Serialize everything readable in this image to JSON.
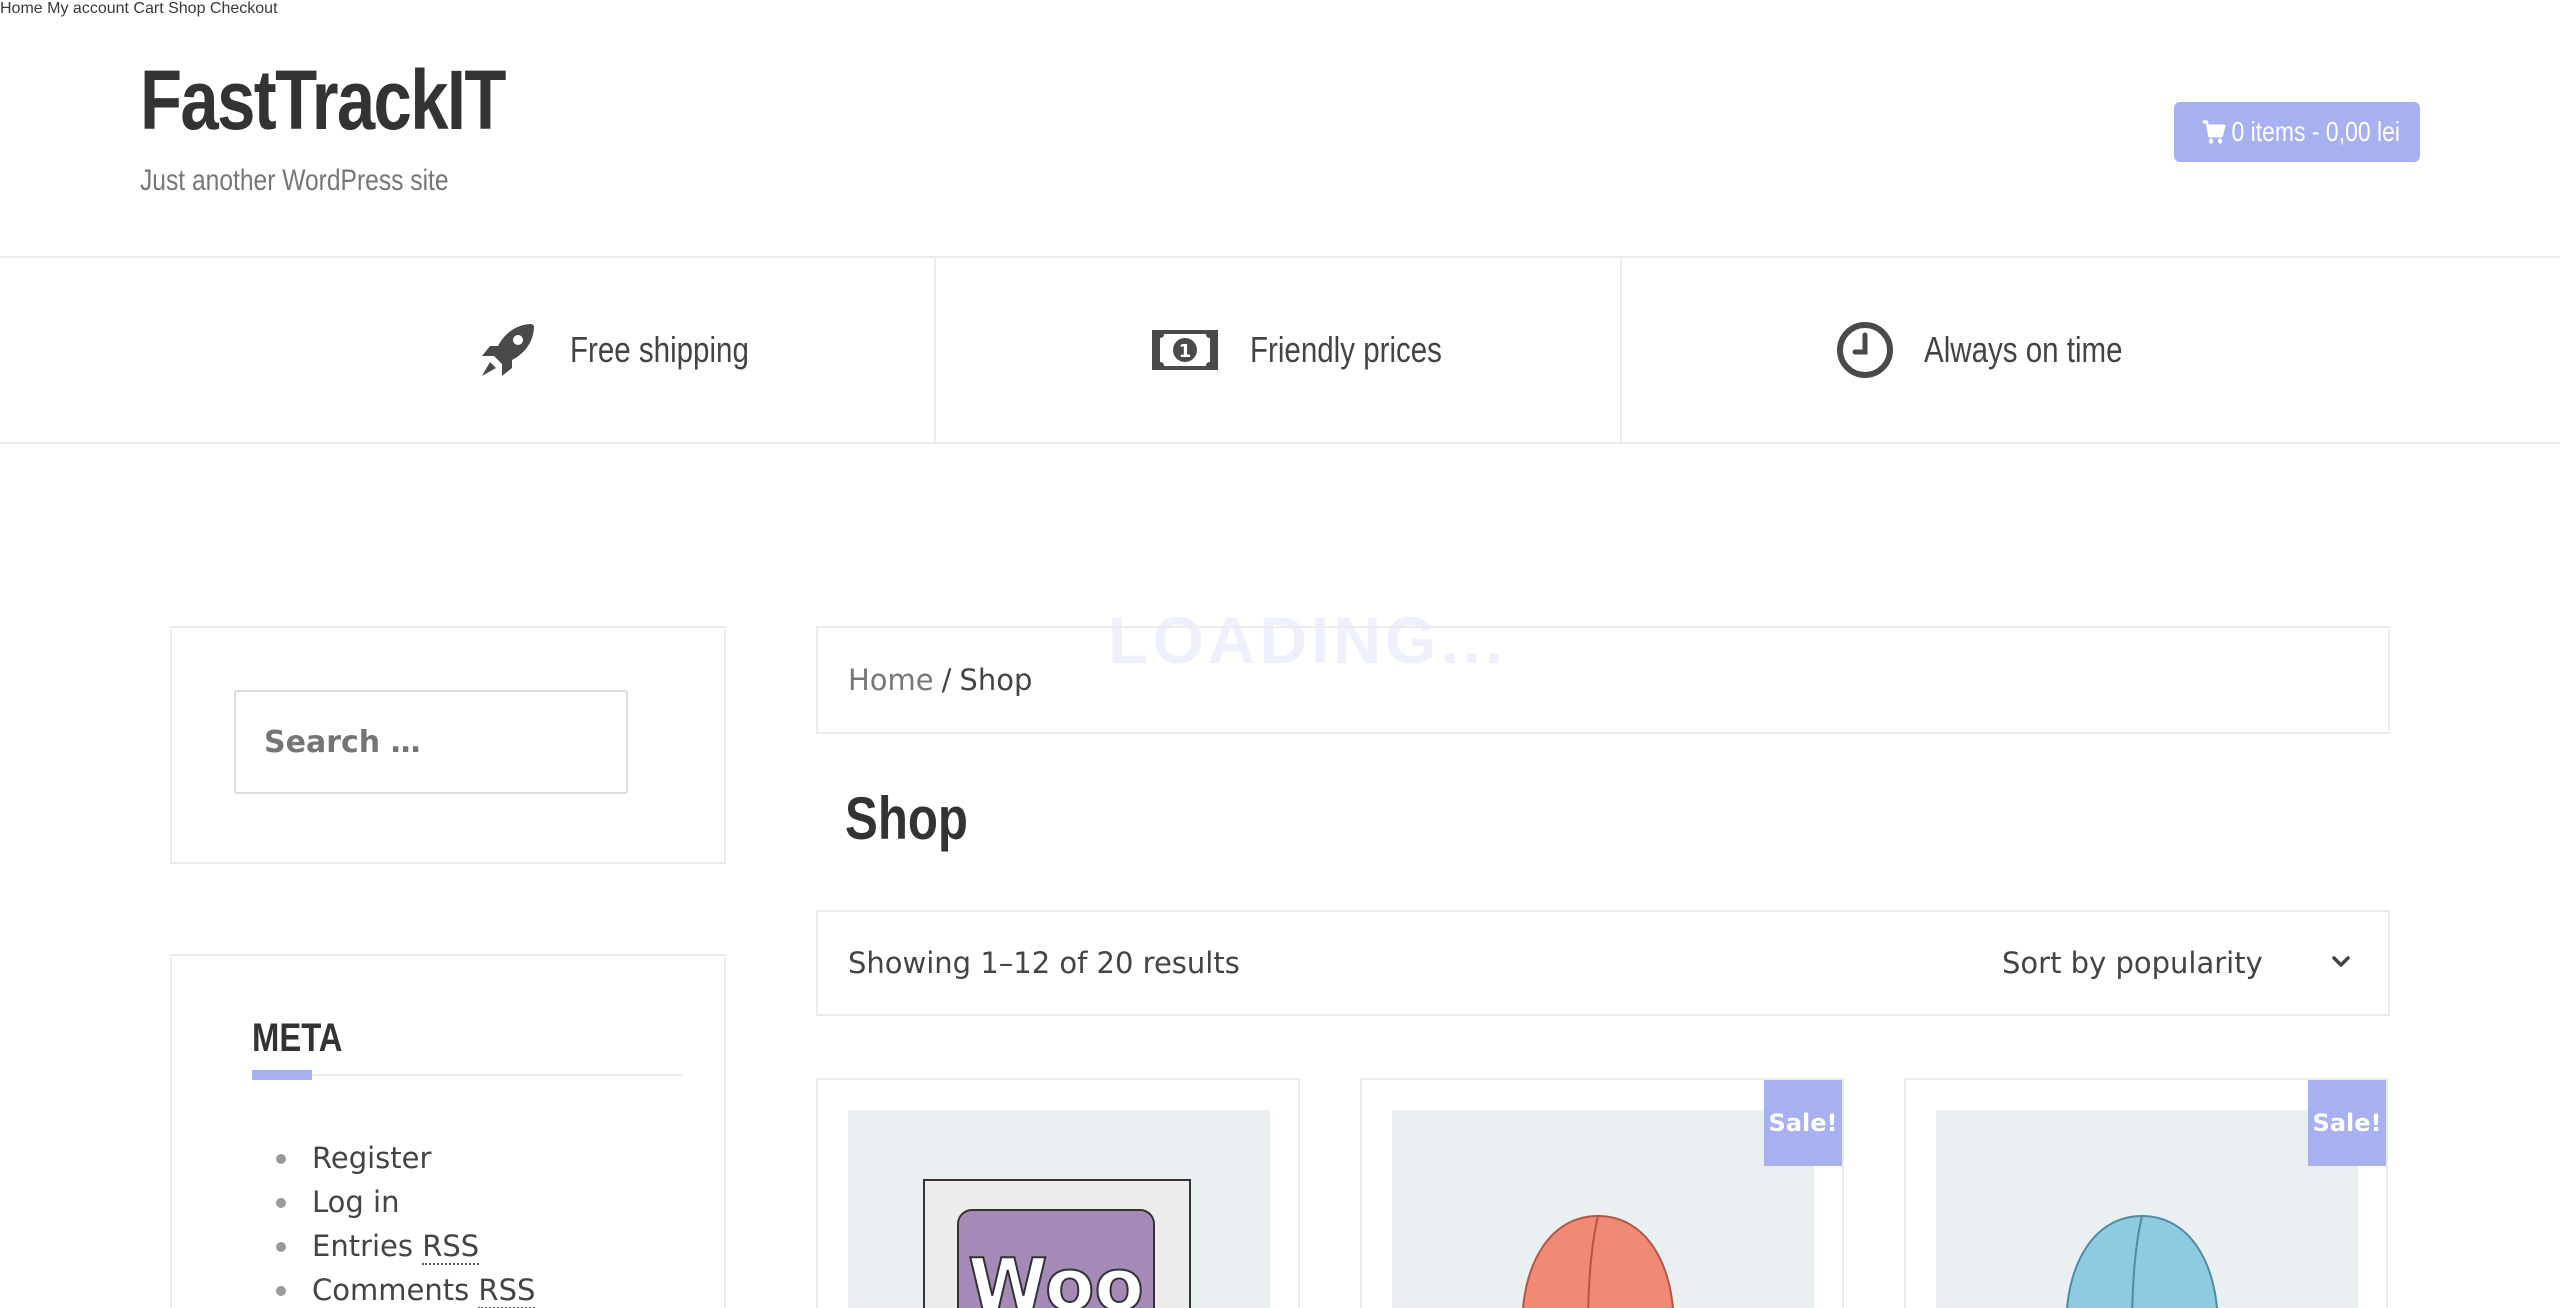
{
  "site": {
    "title": "FastTrackIT",
    "description": "Just another WordPress site"
  },
  "nav": {
    "items": [
      {
        "label": "Home"
      },
      {
        "label": "My account"
      },
      {
        "label": "Cart"
      },
      {
        "label": "Shop"
      },
      {
        "label": "Checkout"
      }
    ],
    "cart_label": "0 items - 0,00 lei",
    "cart_icon": "cart-icon"
  },
  "features": [
    {
      "label": "Free shipping",
      "icon": "rocket-icon"
    },
    {
      "label": "Friendly prices",
      "icon": "money-icon"
    },
    {
      "label": "Always on time",
      "icon": "clock-icon"
    }
  ],
  "loading_text": "LOADING...",
  "sidebar": {
    "search_placeholder": "Search …",
    "meta": {
      "title": "META",
      "links": [
        {
          "label": "Register"
        },
        {
          "label": "Log in"
        },
        {
          "label": "Entries",
          "abbr": "RSS"
        },
        {
          "label": "Comments",
          "abbr": "RSS"
        }
      ]
    }
  },
  "main": {
    "breadcrumb": {
      "home": "Home",
      "separator": "/",
      "current": "Shop"
    },
    "title": "Shop",
    "result_count": "Showing 1–12 of 20 results",
    "sort_selected": "Sort by popularity",
    "products": [
      {
        "sale": false,
        "image": "woo-album-image"
      },
      {
        "sale": true,
        "sale_label": "Sale!",
        "image": "beanie-red-image"
      },
      {
        "sale": true,
        "sale_label": "Sale!",
        "image": "beanie-blue-image"
      }
    ]
  },
  "colors": {
    "accent": "#a7b0f0",
    "text": "#333333",
    "border": "#ececec"
  }
}
